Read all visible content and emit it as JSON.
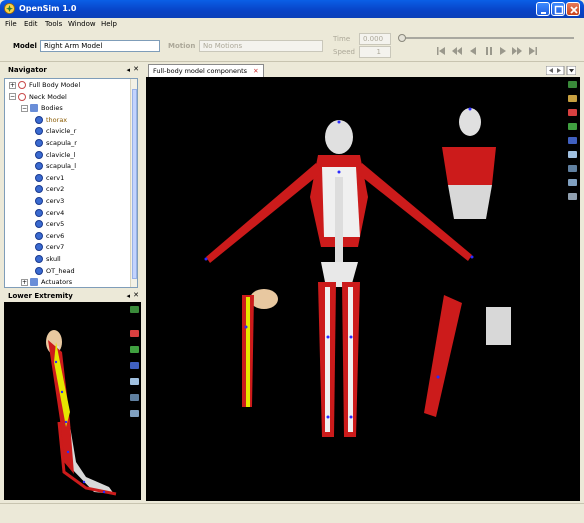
{
  "window": {
    "title": "OpenSim 1.0"
  },
  "menu": [
    "File",
    "Edit",
    "Tools",
    "Window",
    "Help"
  ],
  "toolbar": {
    "model_label": "Model",
    "model_value": "Right Arm Model",
    "motion_label": "Motion",
    "motion_value": "No Motions",
    "time_label": "Time",
    "time_value": "0.000",
    "speed_label": "Speed",
    "speed_value": "1"
  },
  "navigator": {
    "title": "Navigator",
    "tree": [
      {
        "label": "Full Body Model",
        "level": 0,
        "kind": "model",
        "expanded": false
      },
      {
        "label": "Neck Model",
        "level": 0,
        "kind": "model",
        "expanded": true
      },
      {
        "label": "Bodies",
        "level": 1,
        "kind": "folder",
        "expanded": true
      },
      {
        "label": "thorax",
        "level": 2,
        "kind": "body",
        "highlight": true
      },
      {
        "label": "clavicle_r",
        "level": 2,
        "kind": "body"
      },
      {
        "label": "scapula_r",
        "level": 2,
        "kind": "body"
      },
      {
        "label": "clavicle_l",
        "level": 2,
        "kind": "body"
      },
      {
        "label": "scapula_l",
        "level": 2,
        "kind": "body"
      },
      {
        "label": "cerv1",
        "level": 2,
        "kind": "body"
      },
      {
        "label": "cerv2",
        "level": 2,
        "kind": "body"
      },
      {
        "label": "cerv3",
        "level": 2,
        "kind": "body"
      },
      {
        "label": "cerv4",
        "level": 2,
        "kind": "body"
      },
      {
        "label": "cerv5",
        "level": 2,
        "kind": "body"
      },
      {
        "label": "cerv6",
        "level": 2,
        "kind": "body"
      },
      {
        "label": "cerv7",
        "level": 2,
        "kind": "body"
      },
      {
        "label": "skull",
        "level": 2,
        "kind": "body"
      },
      {
        "label": "OT_head",
        "level": 2,
        "kind": "body"
      },
      {
        "label": "Actuators",
        "level": 1,
        "kind": "folder",
        "expanded": false
      }
    ]
  },
  "lower_panel": {
    "title": "Lower Extremity"
  },
  "main_tab": {
    "label": "Full-body model components"
  },
  "colors": {
    "titlebar": "#0842c6",
    "muscle": "#cc1b1b",
    "bone": "#e8e8e8",
    "marker": "#2a2aff",
    "viewport": "#000000"
  }
}
